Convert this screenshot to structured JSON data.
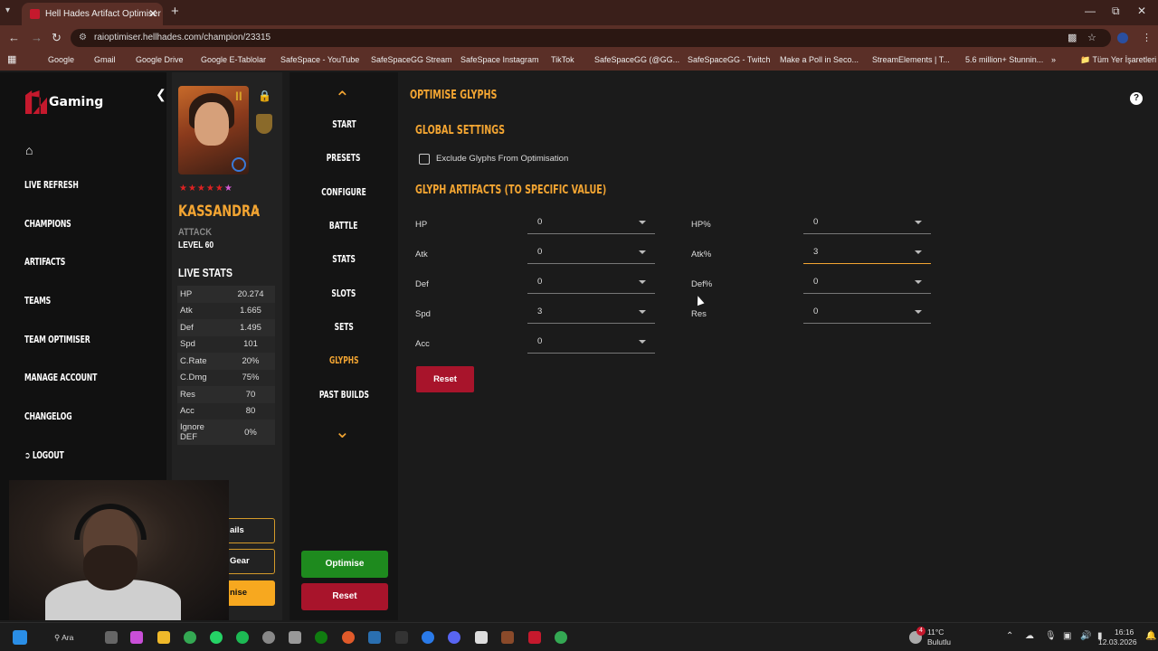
{
  "browser": {
    "tab_title": "Hell Hades Artifact Optimiser",
    "url": "raioptimiser.hellhades.com/champion/23315",
    "bookmarks": [
      {
        "label": "Google",
        "color": "#4285f4"
      },
      {
        "label": "Gmail",
        "color": "#ea4335"
      },
      {
        "label": "Google Drive",
        "color": "#fbbc04"
      },
      {
        "label": "Google E-Tablolar",
        "color": "#0f9d58"
      },
      {
        "label": "SafeSpace - YouTube",
        "color": "#ff0000"
      },
      {
        "label": "SafeSpaceGG Stream",
        "color": "#53fc18"
      },
      {
        "label": "SafeSpace Instagram",
        "color": "#d6249f"
      },
      {
        "label": "TikTok",
        "color": "#111111"
      },
      {
        "label": "SafeSpaceGG (@GG...",
        "color": "#111111"
      },
      {
        "label": "SafeSpaceGG - Twitch",
        "color": "#9146ff"
      },
      {
        "label": "Make a Poll in Seco...",
        "color": "#e8b800"
      },
      {
        "label": "StreamElements | T...",
        "color": "#ffffff"
      },
      {
        "label": "5.6 million+ Stunnin...",
        "color": "#1fb141"
      }
    ],
    "all_bookmarks": "Tüm Yer İşaretleri"
  },
  "sidebar": {
    "brand": "Gaming",
    "items": [
      "Live Refresh",
      "Champions",
      "Artifacts",
      "Teams",
      "Team Optimiser",
      "Manage Account",
      "Changelog",
      "Logout"
    ]
  },
  "champion": {
    "rank": "II",
    "name": "Kassandra",
    "affinity": "Attack",
    "level": "Level 60",
    "live_stats_title": "Live Stats",
    "stats": [
      {
        "label": "HP",
        "value": "20.274"
      },
      {
        "label": "Atk",
        "value": "1.665"
      },
      {
        "label": "Def",
        "value": "1.495"
      },
      {
        "label": "Spd",
        "value": "101"
      },
      {
        "label": "C.Rate",
        "value": "20%"
      },
      {
        "label": "C.Dmg",
        "value": "75%"
      },
      {
        "label": "Res",
        "value": "70"
      },
      {
        "label": "Acc",
        "value": "80"
      },
      {
        "label": "Ignore DEF",
        "value": "0%"
      }
    ],
    "buttons": [
      "ails",
      "Gear",
      "nise"
    ]
  },
  "steps": {
    "items": [
      "Start",
      "Presets",
      "Configure",
      "Battle",
      "Stats",
      "Slots",
      "Sets",
      "Glyphs",
      "Past Builds"
    ],
    "active": "Glyphs",
    "optimise": "Optimise",
    "reset": "Reset"
  },
  "main": {
    "title": "Optimise Glyphs",
    "global_title": "Global Settings",
    "exclude_label": "Exclude Glyphs From Optimisation",
    "exclude_checked": false,
    "glyph_title": "Glyph Artifacts (To Specific Value)",
    "left_fields": [
      {
        "label": "HP",
        "value": "0"
      },
      {
        "label": "Atk",
        "value": "0"
      },
      {
        "label": "Def",
        "value": "0"
      },
      {
        "label": "Spd",
        "value": "3"
      },
      {
        "label": "Acc",
        "value": "0"
      }
    ],
    "right_fields": [
      {
        "label": "HP%",
        "value": "0"
      },
      {
        "label": "Atk%",
        "value": "3"
      },
      {
        "label": "Def%",
        "value": "0"
      },
      {
        "label": "Res",
        "value": "0"
      }
    ],
    "reset": "Reset"
  },
  "taskbar": {
    "search": "Ara",
    "weather_temp": "11°C",
    "weather_desc": "Bulutlu",
    "weather_badge": "4",
    "time": "16:16",
    "date": "12.03.2026"
  },
  "colors": {
    "accent": "#f3a532",
    "danger": "#a8142b",
    "success": "#1e8a1e"
  }
}
